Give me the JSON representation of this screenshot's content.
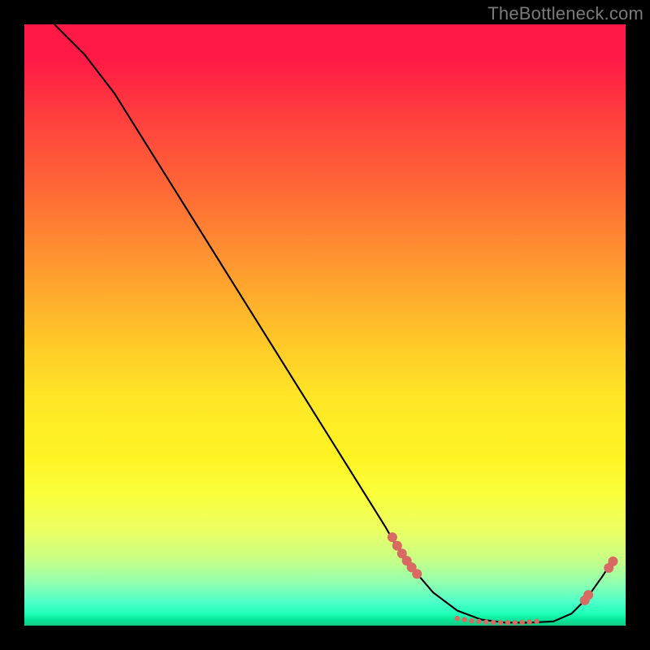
{
  "watermark": "TheBottleneck.com",
  "chart_data": {
    "type": "line",
    "title": "",
    "xlabel": "",
    "ylabel": "",
    "xlim": [
      0,
      100
    ],
    "ylim": [
      0,
      100
    ],
    "grid": false,
    "series": [
      {
        "name": "curve",
        "color": "#000000",
        "x": [
          5,
          10,
          15,
          20,
          25,
          30,
          35,
          40,
          45,
          50,
          55,
          60,
          62,
          65,
          68,
          72,
          76,
          80,
          84,
          88,
          91,
          93.5,
          96,
          98
        ],
        "y": [
          100,
          95,
          88.5,
          80.5,
          72.5,
          64.5,
          56.5,
          48.5,
          40.5,
          32.5,
          24.5,
          16.5,
          13.0,
          9.0,
          5.5,
          2.5,
          1.0,
          0.5,
          0.5,
          0.7,
          2.0,
          4.5,
          8.0,
          11.0
        ]
      }
    ],
    "highlight_dots": {
      "color": "#d86a63",
      "radius_large": 6,
      "radius_small": 3.2,
      "points": [
        {
          "x": 61.2,
          "y": 14.7,
          "r": "l"
        },
        {
          "x": 62.0,
          "y": 13.3,
          "r": "l"
        },
        {
          "x": 62.8,
          "y": 12.0,
          "r": "l"
        },
        {
          "x": 63.6,
          "y": 10.8,
          "r": "l"
        },
        {
          "x": 64.4,
          "y": 9.7,
          "r": "l"
        },
        {
          "x": 65.3,
          "y": 8.6,
          "r": "l"
        },
        {
          "x": 72.0,
          "y": 1.2,
          "r": "s"
        },
        {
          "x": 73.2,
          "y": 1.0,
          "r": "s"
        },
        {
          "x": 74.4,
          "y": 0.8,
          "r": "s"
        },
        {
          "x": 75.6,
          "y": 0.7,
          "r": "s"
        },
        {
          "x": 76.8,
          "y": 0.6,
          "r": "s"
        },
        {
          "x": 78.0,
          "y": 0.55,
          "r": "s"
        },
        {
          "x": 79.2,
          "y": 0.5,
          "r": "s"
        },
        {
          "x": 80.4,
          "y": 0.5,
          "r": "s"
        },
        {
          "x": 81.6,
          "y": 0.5,
          "r": "s"
        },
        {
          "x": 82.8,
          "y": 0.55,
          "r": "s"
        },
        {
          "x": 84.0,
          "y": 0.6,
          "r": "s"
        },
        {
          "x": 85.2,
          "y": 0.7,
          "r": "s"
        },
        {
          "x": 93.2,
          "y": 4.2,
          "r": "l"
        },
        {
          "x": 93.8,
          "y": 5.1,
          "r": "l"
        },
        {
          "x": 97.2,
          "y": 9.6,
          "r": "l"
        },
        {
          "x": 97.9,
          "y": 10.7,
          "r": "l"
        }
      ]
    }
  }
}
